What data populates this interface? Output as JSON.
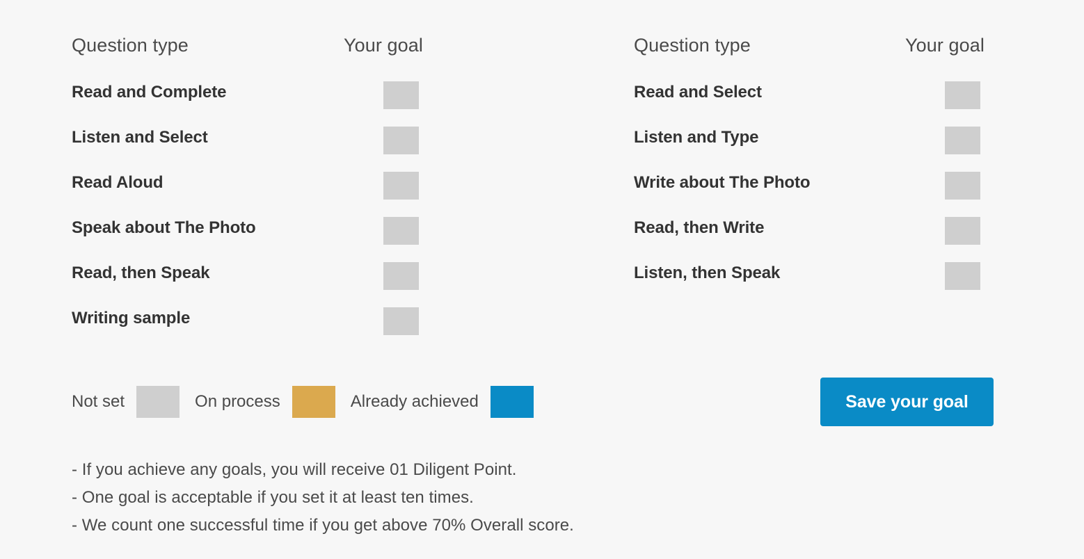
{
  "colors": {
    "background": "#f7f7f7",
    "not_set": "#cfcfcf",
    "on_process": "#dba94e",
    "already_achieved": "#0a8bc6",
    "label_text": "#333333",
    "muted_text": "#4a4a4a",
    "button_text": "#ffffff"
  },
  "columns": [
    {
      "header": {
        "question_type": "Question type",
        "your_goal": "Your goal"
      },
      "rows": [
        {
          "label": "Read and Complete",
          "state": "not_set"
        },
        {
          "label": "Listen and Select",
          "state": "not_set"
        },
        {
          "label": "Read Aloud",
          "state": "not_set"
        },
        {
          "label": "Speak about The Photo",
          "state": "not_set"
        },
        {
          "label": "Read, then Speak",
          "state": "not_set"
        },
        {
          "label": "Writing sample",
          "state": "not_set"
        }
      ]
    },
    {
      "header": {
        "question_type": "Question type",
        "your_goal": "Your goal"
      },
      "rows": [
        {
          "label": "Read and Select",
          "state": "not_set"
        },
        {
          "label": "Listen and Type",
          "state": "not_set"
        },
        {
          "label": "Write about The Photo",
          "state": "not_set"
        },
        {
          "label": "Read, then Write",
          "state": "not_set"
        },
        {
          "label": "Listen, then Speak",
          "state": "not_set"
        }
      ]
    }
  ],
  "legend": [
    {
      "label": "Not set",
      "color": "#cfcfcf",
      "state": "not_set"
    },
    {
      "label": "On process",
      "color": "#dba94e",
      "state": "on_process"
    },
    {
      "label": "Already achieved",
      "color": "#0a8bc6",
      "state": "achieved"
    }
  ],
  "actions": {
    "save_label": "Save your goal"
  },
  "notes": [
    "- If you achieve any goals, you will receive 01 Diligent Point.",
    "- One goal is acceptable if you set it at least ten times.",
    "- We count one successful time if you get above 70% Overall score."
  ]
}
